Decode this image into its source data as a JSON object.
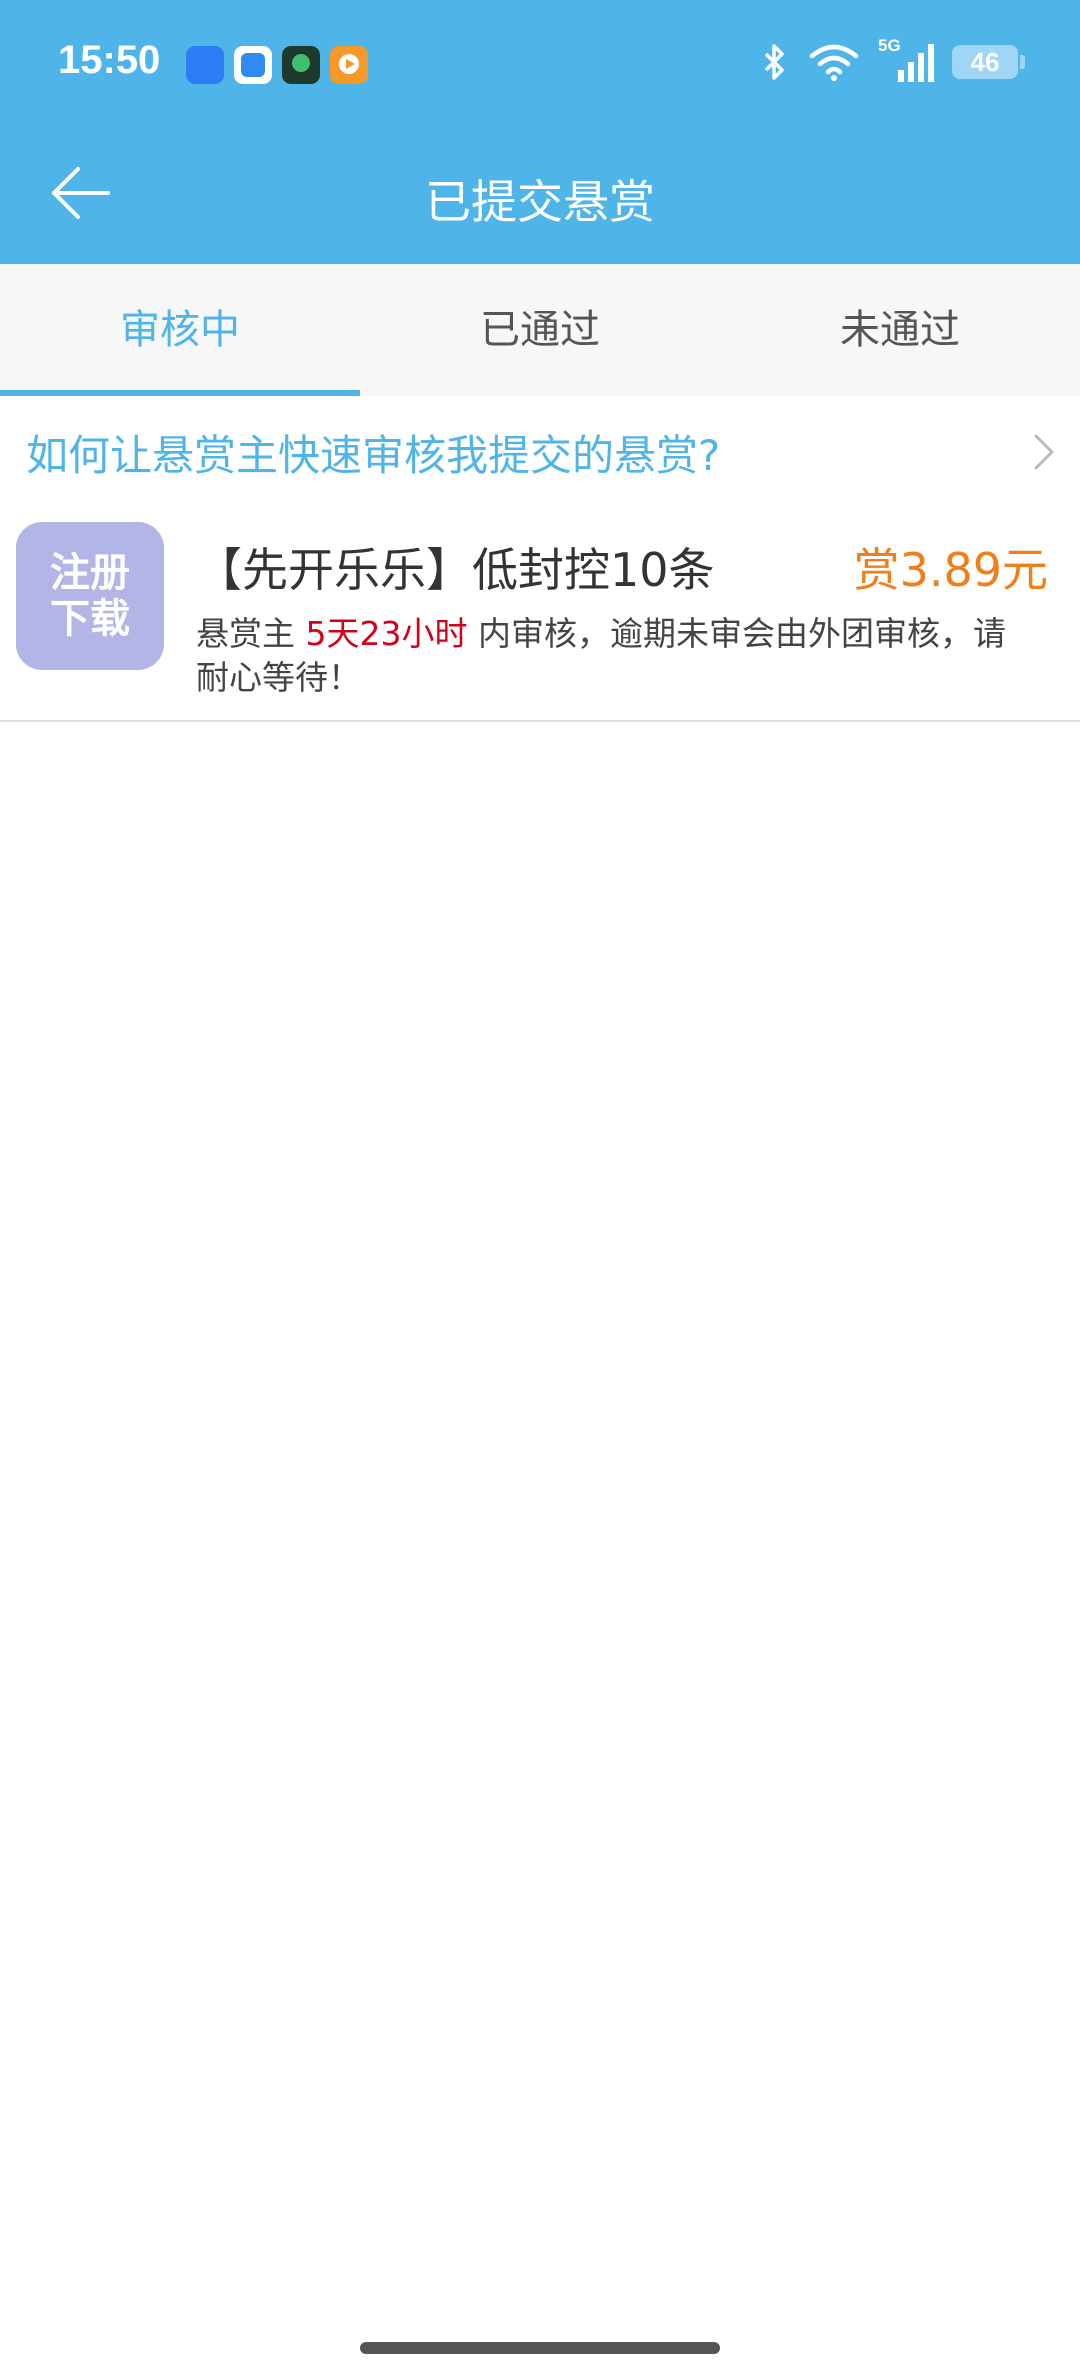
{
  "status_bar": {
    "time": "15:50",
    "battery": "46",
    "network": "5G",
    "icons": [
      "notif-app-1-icon",
      "notif-app-2-icon",
      "notif-app-3-icon",
      "notif-app-4-icon",
      "bluetooth-icon",
      "wifi-icon",
      "signal-icon",
      "battery-icon"
    ]
  },
  "header": {
    "title": "已提交悬赏",
    "back_icon": "back-arrow-icon"
  },
  "tabs": [
    {
      "label": "审核中",
      "active": true
    },
    {
      "label": "已通过",
      "active": false
    },
    {
      "label": "未通过",
      "active": false
    }
  ],
  "help_link": {
    "text": "如何让悬赏主快速审核我提交的悬赏?",
    "icon": "chevron-right-icon"
  },
  "tasks": [
    {
      "icon_line1": "注册",
      "icon_line2": "下载",
      "title": "【先开乐乐】低封控10条",
      "reward": "赏3.89元",
      "desc_prefix": "悬赏主 ",
      "desc_highlight": "5天23小时",
      "desc_suffix": " 内审核，逾期未审会由外团审核，请耐心等待！"
    }
  ],
  "colors": {
    "primary": "#4FB5E8",
    "reward": "#F07E1B",
    "highlight": "#D0021B",
    "app_icon_bg": "#B3B5E6"
  }
}
